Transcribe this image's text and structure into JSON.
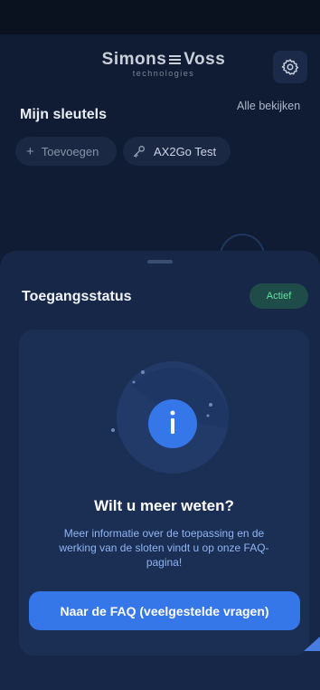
{
  "header": {
    "brand_left": "Simons",
    "brand_right": "Voss",
    "brand_tagline": "technologies",
    "settings_icon": "gear-icon"
  },
  "keys": {
    "title": "Mijn sleutels",
    "see_all": "Alle bekijken",
    "add_label": "Toevoegen",
    "add_icon": "plus-icon",
    "key_label": "AX2Go Test",
    "key_icon": "key-icon"
  },
  "sheet": {
    "title": "Toegangsstatus",
    "status": "Actief",
    "card": {
      "icon": "info-icon",
      "title": "Wilt u meer weten?",
      "description": "Meer informatie over de toepassing en de werking van de sloten vindt u op onze FAQ-pagina!",
      "button_label": "Naar de FAQ (veelgestelde vragen)"
    }
  },
  "colors": {
    "background": "#101c34",
    "sheet": "#162748",
    "card": "#1b2f55",
    "accent": "#3577e8",
    "status_green": "#5fe3a1"
  }
}
